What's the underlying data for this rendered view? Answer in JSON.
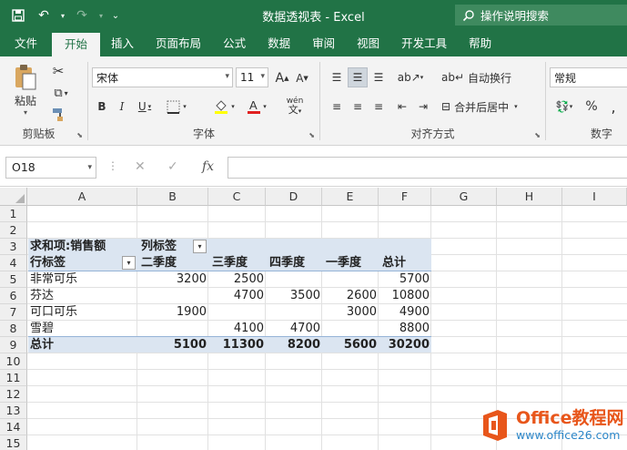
{
  "window": {
    "title": "数据透视表 - Excel"
  },
  "tell_me": {
    "placeholder": "操作说明搜索"
  },
  "tabs": [
    {
      "label": "文件"
    },
    {
      "label": "开始"
    },
    {
      "label": "插入"
    },
    {
      "label": "页面布局"
    },
    {
      "label": "公式"
    },
    {
      "label": "数据"
    },
    {
      "label": "审阅"
    },
    {
      "label": "视图"
    },
    {
      "label": "开发工具"
    },
    {
      "label": "帮助"
    }
  ],
  "active_tab": "开始",
  "ribbon": {
    "clipboard": {
      "label": "剪贴板",
      "paste_label": "粘贴"
    },
    "font": {
      "label": "字体",
      "font_name": "宋体",
      "font_size": "11",
      "phonetic_label": "wén"
    },
    "alignment": {
      "label": "对齐方式",
      "wrap_label": "自动换行",
      "merge_label": "合并后居中"
    },
    "number": {
      "label": "数字",
      "format": "常规",
      "percent": "%"
    }
  },
  "formula_bar": {
    "name_box": "O18",
    "formula": ""
  },
  "columns": [
    "A",
    "B",
    "C",
    "D",
    "E",
    "F",
    "G",
    "H",
    "I"
  ],
  "rows": [
    "1",
    "2",
    "3",
    "4",
    "5",
    "6",
    "7",
    "8",
    "9",
    "10",
    "11",
    "12",
    "13",
    "14",
    "15",
    "16"
  ],
  "pivot": {
    "value_label": "求和项:销售额",
    "col_label": "列标签",
    "row_label": "行标签",
    "headers": [
      "二季度",
      "三季度",
      "四季度",
      "一季度",
      "总计"
    ],
    "data": [
      {
        "name": "非常可乐",
        "values": [
          "3200",
          "2500",
          "",
          "",
          "5700"
        ]
      },
      {
        "name": "芬达",
        "values": [
          "",
          "4700",
          "3500",
          "2600",
          "10800"
        ]
      },
      {
        "name": "可口可乐",
        "values": [
          "1900",
          "",
          "",
          "3000",
          "4900"
        ]
      },
      {
        "name": "雪碧",
        "values": [
          "",
          "4100",
          "4700",
          "",
          "8800"
        ]
      }
    ],
    "total_label": "总计",
    "totals": [
      "5100",
      "11300",
      "8200",
      "5600",
      "30200"
    ]
  },
  "watermark": {
    "title": "Office教程网",
    "url": "www.office26.com"
  },
  "colors": {
    "excel_green": "#217346",
    "pivot_band": "#dbe5f1",
    "watermark_orange": "#e8561b"
  }
}
